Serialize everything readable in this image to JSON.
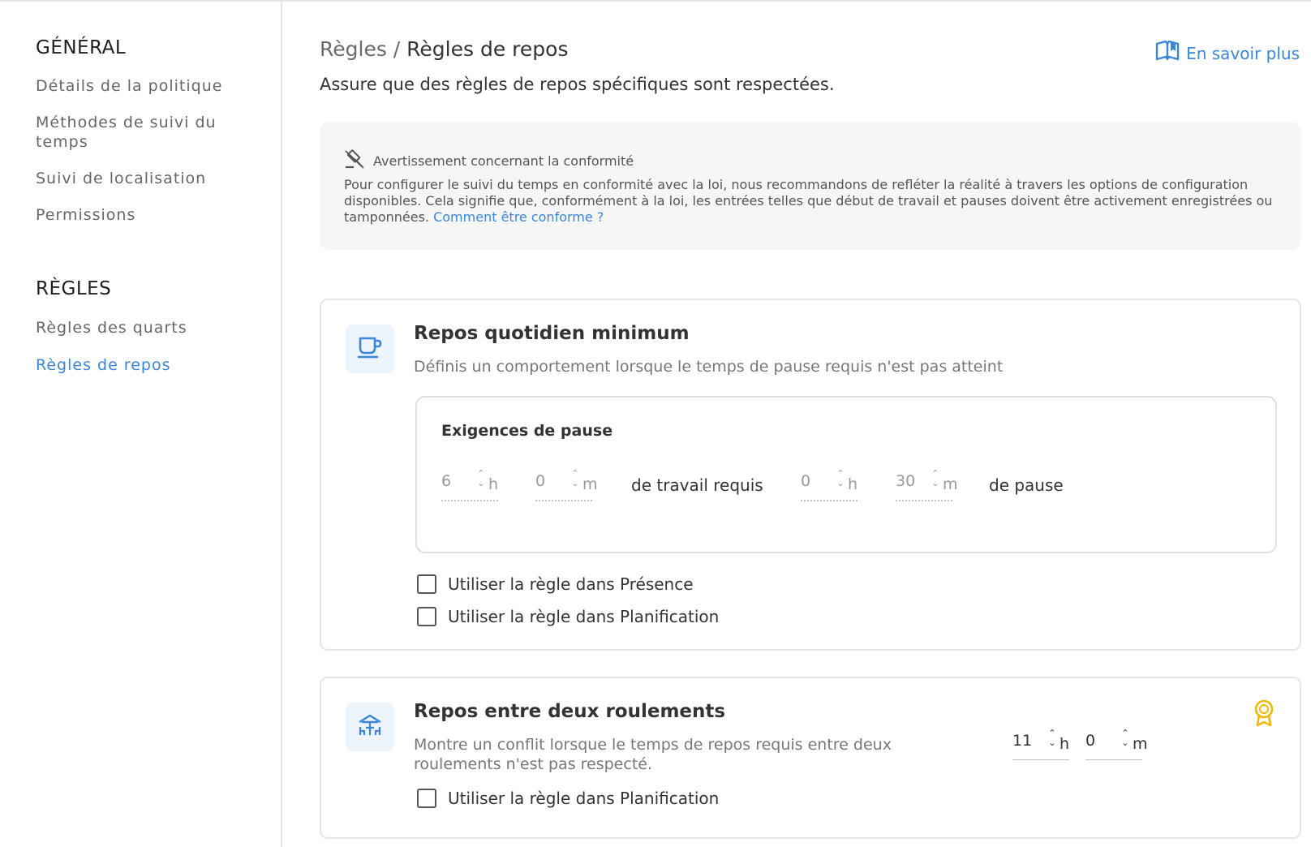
{
  "sidebar": {
    "general_title": "GÉNÉRAL",
    "general_items": [
      "Détails de la politique",
      "Méthodes de suivi du temps",
      "Suivi de localisation",
      "Permissions"
    ],
    "rules_title": "RÈGLES",
    "rules_items": [
      "Règles des quarts",
      "Règles de repos"
    ],
    "active_item": "Règles de repos"
  },
  "header": {
    "breadcrumb_parent": "Règles /",
    "breadcrumb_current": "Règles de repos",
    "learn_more": "En savoir plus",
    "subtitle": "Assure que des règles de repos spécifiques sont respectées."
  },
  "warning": {
    "title": "Avertissement concernant la conformité",
    "text": "Pour configurer le suivi du temps en conformité avec la loi, nous recommandons de refléter la réalité à travers les options de configuration disponibles. Cela signifie que, conformément à la loi, les entrées telles que début de travail et pauses doivent être activement enregistrées ou tamponnées.",
    "link": "Comment être conforme ?"
  },
  "daily_rest": {
    "title": "Repos quotidien minimum",
    "description": "Définis un comportement lorsque le temps de pause requis n'est pas atteint",
    "requirements_title": "Exigences de pause",
    "work_hours": "6",
    "work_minutes": "0",
    "work_label": "de travail requis",
    "break_hours": "0",
    "break_minutes": "30",
    "break_label": "de pause",
    "unit_h": "h",
    "unit_m": "m",
    "checkbox_presence": "Utiliser la règle dans Présence",
    "checkbox_planning": "Utiliser la règle dans Planification",
    "presence_checked": false,
    "planning_checked": false
  },
  "shift_rest": {
    "title": "Repos entre deux roulements",
    "description": "Montre un conflit lorsque le temps de repos requis entre deux roulements n'est pas respecté.",
    "hours": "11",
    "minutes": "0",
    "unit_h": "h",
    "unit_m": "m",
    "checkbox_planning": "Utiliser la règle dans Planification",
    "planning_checked": false
  },
  "colors": {
    "accent": "#3a86d8",
    "badge": "#f2b705",
    "icon_bg": "#edf4fc"
  },
  "icons": {
    "learn_more": "open-book-icon",
    "warning": "gavel-icon",
    "daily_rest": "coffee-cup-icon",
    "shift_rest": "rest-area-icon",
    "badge": "award-badge-icon"
  }
}
